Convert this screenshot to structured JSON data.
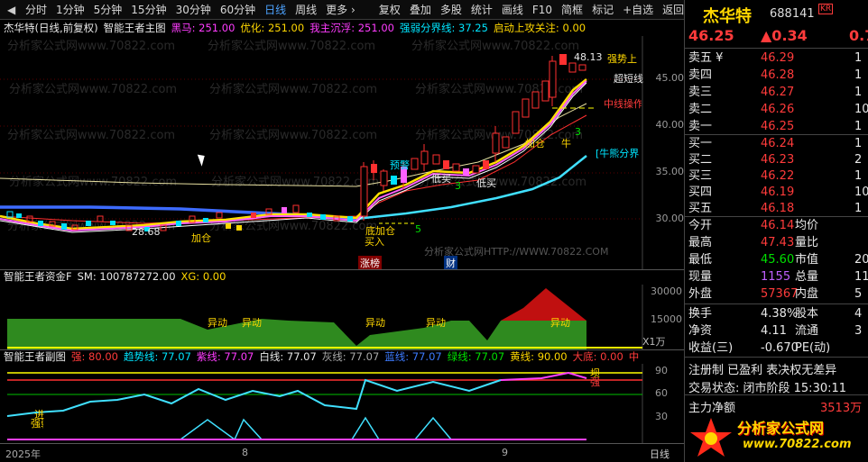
{
  "toolbar": {
    "items": [
      "分时",
      "1分钟",
      "5分钟",
      "15分钟",
      "30分钟",
      "60分钟",
      "日线",
      "周线",
      "更多 ›"
    ],
    "right_items": [
      "复权",
      "叠加",
      "多股",
      "统计",
      "画线",
      "F10",
      "简框",
      "标记",
      "+自选",
      "返回"
    ],
    "active": "日线"
  },
  "main_header": {
    "stock": "杰华特(日线,前复权)",
    "indicator": "智能王者主图",
    "black_horse": "黑马: 251.00",
    "optimize": "优化: 251.00",
    "main_up": "我主沉浮: 251.00",
    "split": "强弱分界线: 37.25",
    "attention": "启动上攻关注: 0.00"
  },
  "main_axis": [
    "45.00",
    "40.00",
    "35.00",
    "30.00"
  ],
  "main_labels": {
    "high": "48.13",
    "strong_up": "强势上",
    "super_short": "超短线",
    "mid_line": "中线操作",
    "bull_bear": "[牛熊分界",
    "buy_sell": "加仓",
    "bull": "牛",
    "three_a": "3",
    "three_b": "3",
    "five": "5",
    "warn": "预警",
    "low_buy1": "低买",
    "low_buy2": "低买",
    "low": "28.68",
    "add": "加仓",
    "bottom_add": "底加仓",
    "buy_in": "买入",
    "zt": "涨榜",
    "cai": "财"
  },
  "watermark": "分析家公式网www.70822.com",
  "watermark2": "分析家公式网HTTP://WWW.70822.COM",
  "fund_header": {
    "name": "智能王者资金F",
    "sm": "SM: 100787272.00",
    "xg": "XG: 0.00"
  },
  "fund_axis": [
    "30000",
    "15000"
  ],
  "fund_unit": "X1万",
  "fund_labels": [
    "异动",
    "异动",
    "异动",
    "异动",
    "异动"
  ],
  "sub_header": {
    "name": "智能王者副图",
    "strong": "强: 80.00",
    "trend": "趋势线: 77.07",
    "purple": "紫线: 77.07",
    "white": "白线: 77.07",
    "gray": "灰线: 77.07",
    "blue": "蓝线: 77.07",
    "green": "绿线: 77.07",
    "yellow": "黄线: 90.00",
    "bottom": "大底: 0.00",
    "mid": "中"
  },
  "sub_axis": [
    "90",
    "60",
    "30"
  ],
  "sub_labels": {
    "jun": "坝",
    "qiang": "强",
    "jin": "进",
    "ruo": "强弱"
  },
  "date_axis": [
    "2025年",
    "8",
    "9"
  ],
  "date_mode": "日线",
  "quote": {
    "name": "杰华特",
    "code": "688141",
    "tag": "KR",
    "price": "46.25",
    "change": "▲0.34",
    "pct": "0.74"
  },
  "asks": [
    {
      "l": "卖五 ¥",
      "p": "46.29",
      "v": "1"
    },
    {
      "l": "卖四",
      "p": "46.28",
      "v": "1"
    },
    {
      "l": "卖三",
      "p": "46.27",
      "v": "1"
    },
    {
      "l": "卖二",
      "p": "46.26",
      "v": "10"
    },
    {
      "l": "卖一",
      "p": "46.25",
      "v": "1"
    }
  ],
  "bids": [
    {
      "l": "买一",
      "p": "46.24",
      "v": "1"
    },
    {
      "l": "买二",
      "p": "46.23",
      "v": "2"
    },
    {
      "l": "买三",
      "p": "46.22",
      "v": "1"
    },
    {
      "l": "买四",
      "p": "46.19",
      "v": "10"
    },
    {
      "l": "买五",
      "p": "46.18",
      "v": "1"
    }
  ],
  "stats": [
    {
      "l": "今开",
      "v": "46.14",
      "l2": "均价",
      "r": ""
    },
    {
      "l": "最高",
      "v": "47.43",
      "l2": "量比",
      "r": ""
    },
    {
      "l": "最低",
      "v": "45.60",
      "l2": "市值",
      "r": "20"
    },
    {
      "l": "现量",
      "v": "1155",
      "l2": "总量",
      "r": "11"
    },
    {
      "l": "外盘",
      "v": "57367",
      "l2": "内盘",
      "r": "5"
    }
  ],
  "fin": [
    {
      "l": "换手",
      "v": "4.38%",
      "l2": "股本",
      "r": "4"
    },
    {
      "l": "净资",
      "v": "4.11",
      "l2": "流通",
      "r": "3"
    },
    {
      "l": "收益(三)",
      "v": "-0.670",
      "l2": "PE(动)",
      "r": ""
    }
  ],
  "notice": "注册制 已盈利 表决权无差异",
  "trade_status": "交易状态: 闭市阶段 15:30:11",
  "net": {
    "l": "主力净额",
    "v": "3513万"
  },
  "logo": {
    "main": "分析家公式网",
    "url": "www.70822.com"
  }
}
